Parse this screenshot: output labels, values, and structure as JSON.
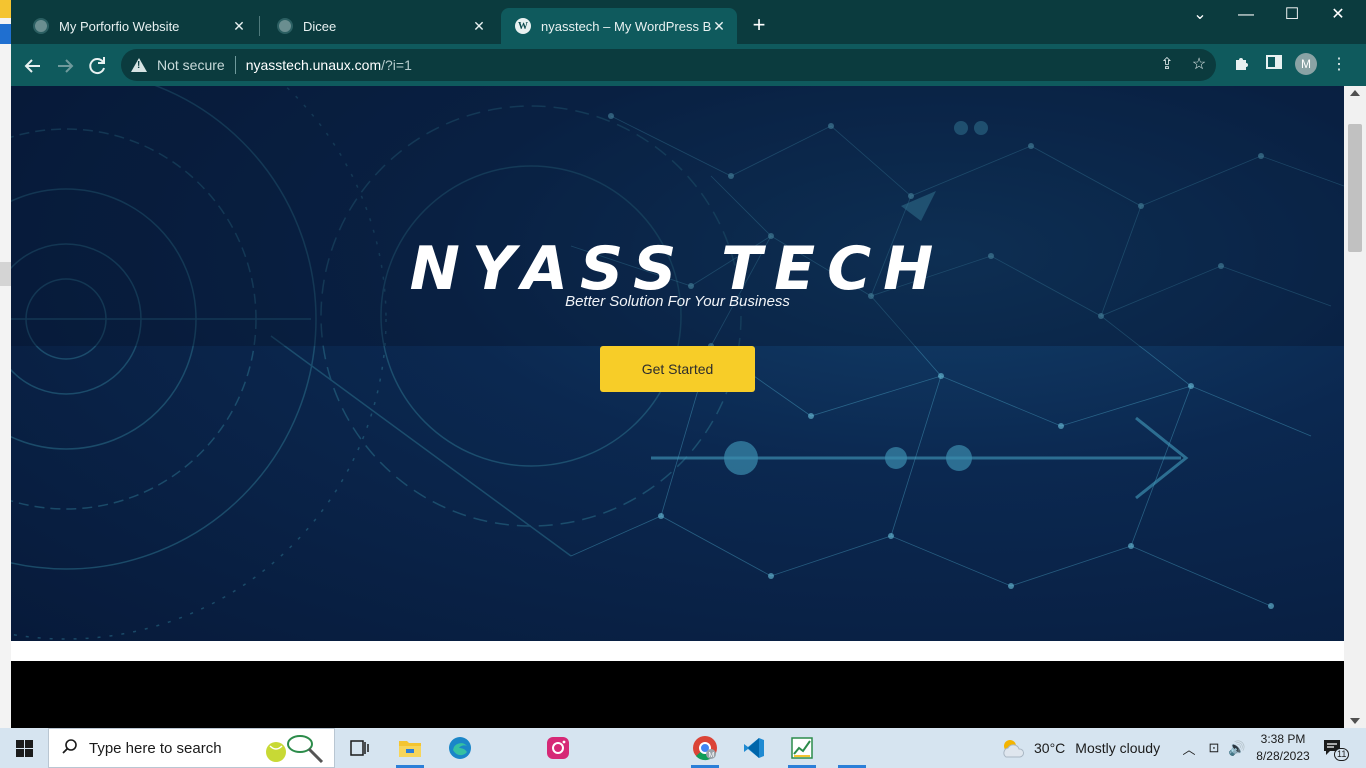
{
  "browser": {
    "tabs": [
      {
        "title": "My Porforfio Website",
        "icon": "globe-icon",
        "active": false
      },
      {
        "title": "Dicee",
        "icon": "globe-icon",
        "active": false
      },
      {
        "title": "nyasstech – My WordPress Blog",
        "icon": "wordpress-icon",
        "active": true
      }
    ],
    "new_tab_icon": "+",
    "window_controls": {
      "tab_search": "⌄",
      "minimize": "—",
      "maximize": "☐",
      "close": "✕"
    },
    "address": {
      "security_label": "Not secure",
      "host": "nyasstech.unaux.com",
      "path": "/?i=1"
    },
    "profile_initial": "M"
  },
  "page": {
    "hero": {
      "title": "NYASS TECH",
      "subtitle": "Better Solution For Your Business",
      "cta_label": "Get Started",
      "cta_color": "#f7cd28"
    }
  },
  "taskbar": {
    "search_placeholder": "Type here to search",
    "weather": {
      "temperature": "30°C",
      "condition": "Mostly cloudy"
    },
    "clock": {
      "time": "3:38 PM",
      "date": "8/28/2023"
    },
    "notification_count": "11"
  }
}
